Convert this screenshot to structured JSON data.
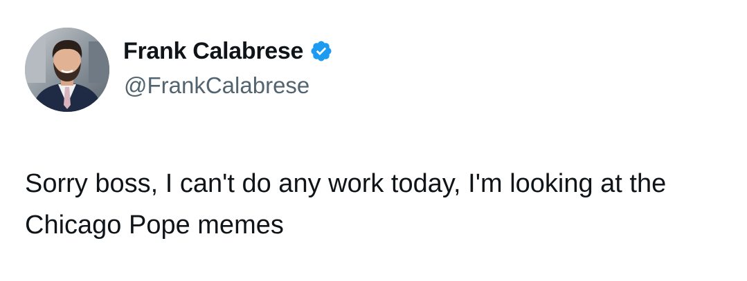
{
  "author": {
    "display_name": "Frank Calabrese",
    "handle": "@FrankCalabrese",
    "verified": true,
    "verified_badge_icon": "verified-badge-icon",
    "badge_color": "#1d9bf0",
    "avatar_icon": "profile-photo"
  },
  "tweet": {
    "text": "Sorry boss, I can't do any work today, I'm looking at the Chicago Pope memes"
  }
}
